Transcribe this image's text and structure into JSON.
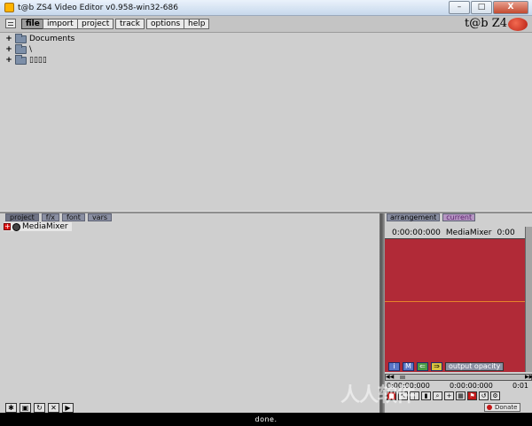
{
  "window": {
    "title": "t@b ZS4 Video Editor v0.958-win32-686",
    "buttons": {
      "minimize": "–",
      "maximize": "□",
      "close": "X"
    }
  },
  "menubar": {
    "items": [
      {
        "label": "file",
        "active": true
      },
      {
        "label": "import"
      },
      {
        "label": "project"
      },
      {
        "label": "track"
      },
      {
        "label": "options"
      },
      {
        "label": "help"
      }
    ],
    "logo": "t@b Z4"
  },
  "file_tree": [
    {
      "expander": "+",
      "label": "Documents"
    },
    {
      "expander": "+",
      "label": "\\"
    },
    {
      "expander": "+",
      "label": "▯▯▯▯"
    }
  ],
  "lower_left": {
    "tabs": [
      "project",
      "f/x",
      "font",
      "vars"
    ],
    "media_item": {
      "expander": "+",
      "label": "MediaMixer"
    }
  },
  "right_pane": {
    "tabs": [
      "arrangement",
      "current"
    ],
    "timeline": {
      "start": "0:00:00:000",
      "track": "MediaMixer",
      "end": "0:00"
    },
    "param_buttons": [
      "i",
      "M",
      "",
      ""
    ],
    "output_opacity": "output opacity",
    "timecodes": [
      "0:00:00:000",
      "0:00:00:000",
      "0:01"
    ],
    "donate": "Donate",
    "colors": {
      "canvas": "#b12a37",
      "line": "#e6842a"
    }
  },
  "status": "done.",
  "watermark": "人人软件"
}
